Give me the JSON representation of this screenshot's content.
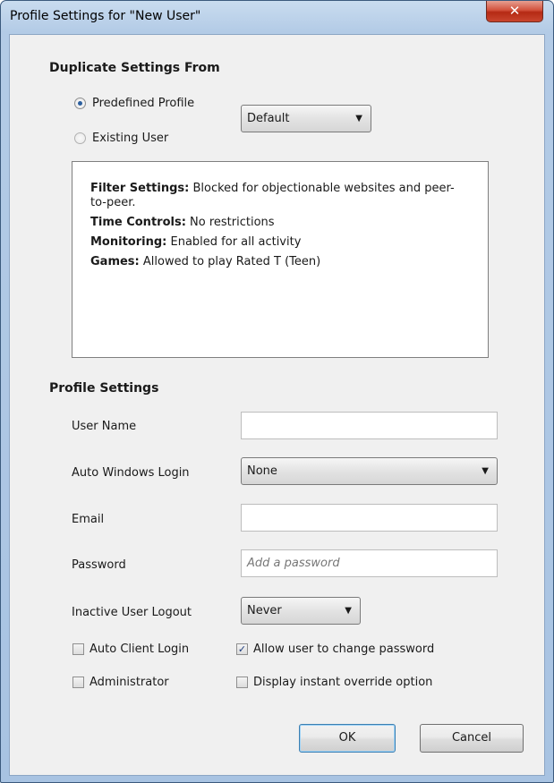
{
  "window": {
    "title": "Profile Settings for \"New User\"",
    "close_glyph": "✕"
  },
  "duplicate": {
    "heading": "Duplicate Settings From",
    "options": [
      {
        "label": "Predefined Profile",
        "selected": true
      },
      {
        "label": "Existing User",
        "selected": false
      }
    ],
    "profile_select": {
      "value": "Default",
      "arrow": "▼"
    },
    "summary": [
      {
        "key": "Filter Settings:",
        "value": " Blocked for objectionable websites and peer-to-peer."
      },
      {
        "key": "Time Controls:",
        "value": " No restrictions"
      },
      {
        "key": "Monitoring:",
        "value": " Enabled for all activity"
      },
      {
        "key": "Games:",
        "value": " Allowed to play Rated T (Teen)"
      }
    ]
  },
  "profile": {
    "heading": "Profile Settings",
    "user_name": {
      "label": "User Name",
      "value": ""
    },
    "auto_login": {
      "label": "Auto Windows Login",
      "value": "None",
      "arrow": "▼"
    },
    "email": {
      "label": "Email",
      "value": ""
    },
    "password": {
      "label": "Password",
      "placeholder": "Add a password"
    },
    "logout": {
      "label": "Inactive User Logout",
      "value": "Never",
      "arrow": "▼"
    },
    "checkboxes": [
      {
        "label": "Auto Client Login",
        "checked": false
      },
      {
        "label": "Allow user to change password",
        "checked": true
      },
      {
        "label": "Administrator",
        "checked": false
      },
      {
        "label": "Display instant override option",
        "checked": false
      }
    ]
  },
  "buttons": {
    "ok": "OK",
    "cancel": "Cancel"
  },
  "colors": {
    "accent": "#2c5f9e",
    "close_red": "#c9452e",
    "frame_blue": "#a8c3e2"
  },
  "icons": {
    "close": "close-icon",
    "dropdown": "chevron-down-icon",
    "checkmark": "check-icon"
  }
}
